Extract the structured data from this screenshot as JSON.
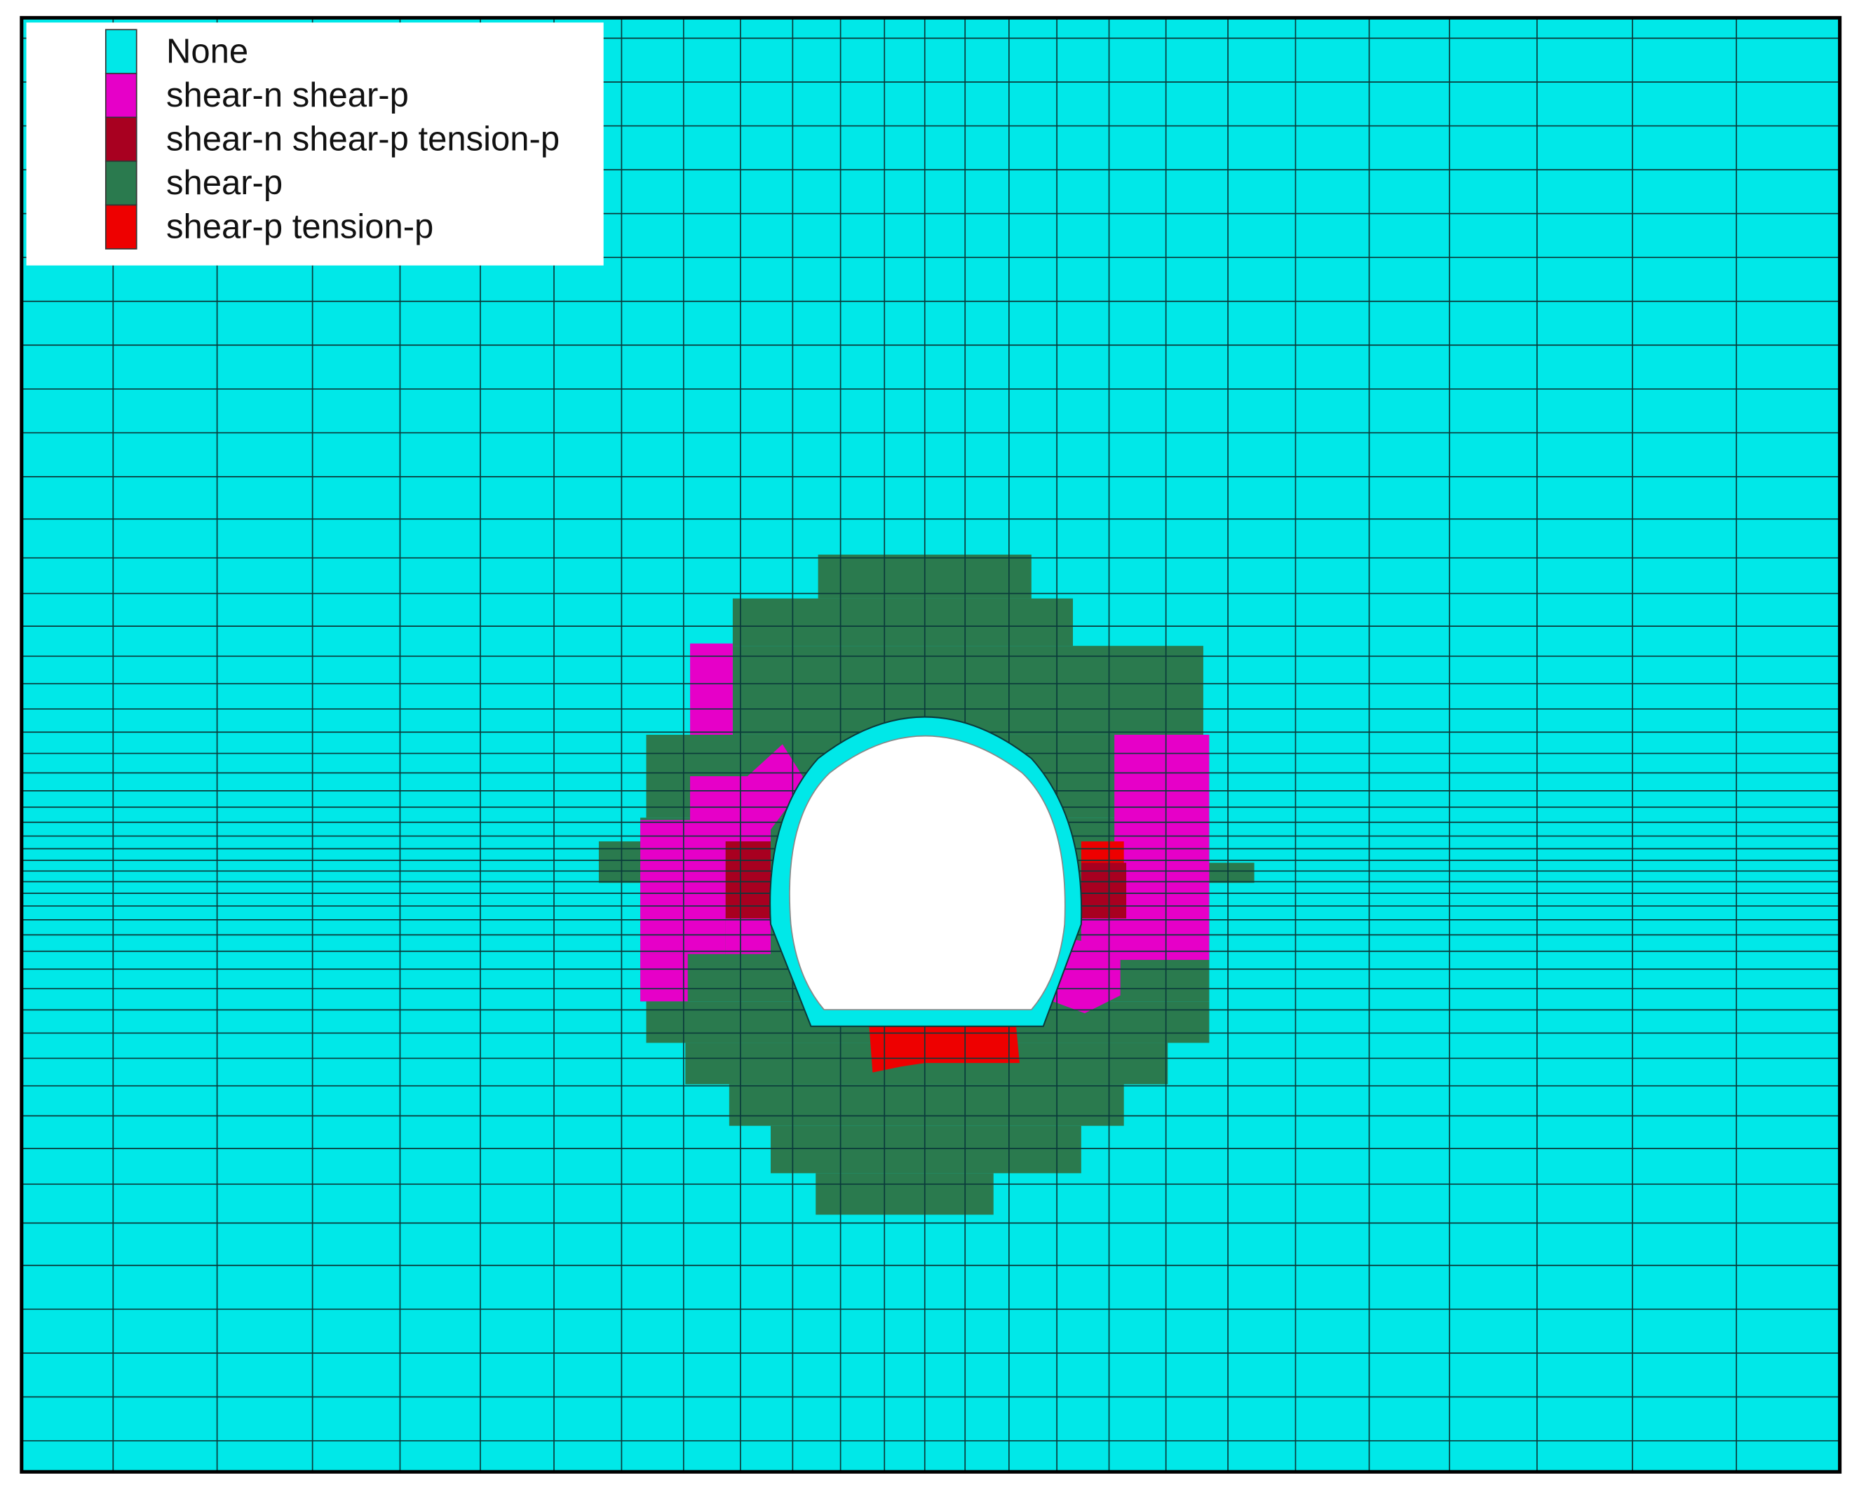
{
  "legend": {
    "items": [
      {
        "label": "None",
        "color": "#00e8e8"
      },
      {
        "label": "shear-n shear-p",
        "color": "#e600c8"
      },
      {
        "label": "shear-n shear-p tension-p",
        "color": "#a80020"
      },
      {
        "label": "shear-p",
        "color": "#2a7a4e"
      },
      {
        "label": "shear-p tension-p",
        "color": "#ee0000"
      }
    ]
  },
  "colors": {
    "mesh_line": "#0a3a3a",
    "frame": "#000000",
    "opening": "#ffffff"
  }
}
